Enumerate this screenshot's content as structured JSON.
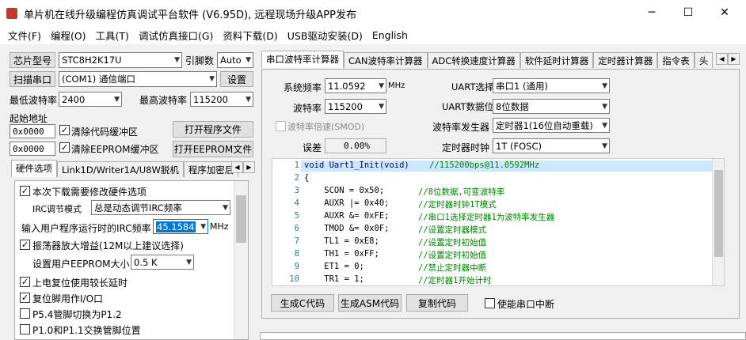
{
  "window": {
    "title": "单片机在线升级编程仿真调试平台软件 (V6.95D), 远程现场升级APP发布",
    "minimize": "─",
    "maximize": "☐",
    "close": "✕"
  },
  "menu": [
    "文件(F)",
    "编程(O)",
    "工具(T)",
    "调试仿真接口(G)",
    "资料下载(D)",
    "USB驱动安装(D)",
    "English"
  ],
  "left": {
    "chip_model_btn": "芯片型号",
    "chip_model": "STC8H2K17U",
    "pin_count_label": "引脚数",
    "pin_count": "Auto",
    "scan_port_btn": "扫描串口",
    "port": "(COM1) 通信端口",
    "settings_btn": "设置",
    "min_baud_label": "最低波特率",
    "min_baud": "2400",
    "max_baud_label": "最高波特率",
    "max_baud": "115200",
    "start_addr_label": "起始地址",
    "addr1": "0x0000",
    "clear_code_label": "清除代码缓冲区",
    "open_prog_btn": "打开程序文件",
    "addr2": "0x0000",
    "clear_eeprom_label": "清除EEPROM缓冲区",
    "open_eeprom_btn": "打开EEPROM文件",
    "tabs": [
      "硬件选项",
      "Link1D/Writer1A/U8W脱机",
      "程序加密后"
    ],
    "hw": {
      "modify_opts": "本次下载需要修改硬件选项",
      "irc_mode_label": "IRC调节模式",
      "irc_mode": "总是动态调节IRC频率",
      "freq_label": "输入用户程序运行时的IRC频率",
      "freq": "45.1584",
      "freq_unit": "MHz",
      "osc_gain": "振荡器放大增益(12M以上建议选择)",
      "eeprom_size_label": "设置用户EEPROM大小",
      "eeprom_size": "0.5 K",
      "power_delay": "上电复位使用较长延时",
      "reset_pin": "复位脚用作I/O口",
      "p54": "P5.4管脚切换为P1.2",
      "p10": "P1.0和P1.1交换管脚位置"
    }
  },
  "right": {
    "tabs": [
      "串口波特率计算器",
      "CAN波特率计算器",
      "ADC转换速度计算器",
      "软件延时计算器",
      "定时器计算器",
      "指令表",
      "头"
    ],
    "sys_freq_label": "系统频率",
    "sys_freq": "11.0592",
    "mhz": "MHz",
    "baud_label": "波特率",
    "baud": "115200",
    "double_baud": "波特率倍速(SMOD)",
    "error_label": "误差",
    "error": "0.00%",
    "uart_sel_label": "UART选择",
    "uart_sel": "串口1 (通用)",
    "uart_bits_label": "UART数据位",
    "uart_bits": "8位数据",
    "baud_gen_label": "波特率发生器",
    "baud_gen": "定时器1(16位自动重载)",
    "timer_clk_label": "定时器时钟",
    "timer_clk": "1T  (FOSC)",
    "code_lines": [
      {
        "n": "1",
        "c": "void Uart1_Init(void)",
        "m": "//115200bps@11.0592MHz"
      },
      {
        "n": "2",
        "c": "{",
        "m": ""
      },
      {
        "n": "3",
        "c": "    SCON = 0x50;",
        "m": "//8位数据,可变波特率"
      },
      {
        "n": "4",
        "c": "    AUXR |= 0x40;",
        "m": "//定时器时钟1T模式"
      },
      {
        "n": "5",
        "c": "    AUXR &= 0xFE;",
        "m": "//串口1选择定时器1为波特率发生器"
      },
      {
        "n": "6",
        "c": "    TMOD &= 0x0F;",
        "m": "//设置定时器模式"
      },
      {
        "n": "7",
        "c": "    TL1 = 0xE8;",
        "m": "//设置定时初始值"
      },
      {
        "n": "8",
        "c": "    TH1 = 0xFF;",
        "m": "//设置定时初始值"
      },
      {
        "n": "9",
        "c": "    ET1 = 0;",
        "m": "//禁止定时器中断"
      },
      {
        "n": "10",
        "c": "    TR1 = 1;",
        "m": "//定时器1开始计时"
      }
    ],
    "gen_c_btn": "生成C代码",
    "gen_asm_btn": "生成ASM代码",
    "copy_btn": "复制代码",
    "enable_int": "使能串口中断"
  }
}
